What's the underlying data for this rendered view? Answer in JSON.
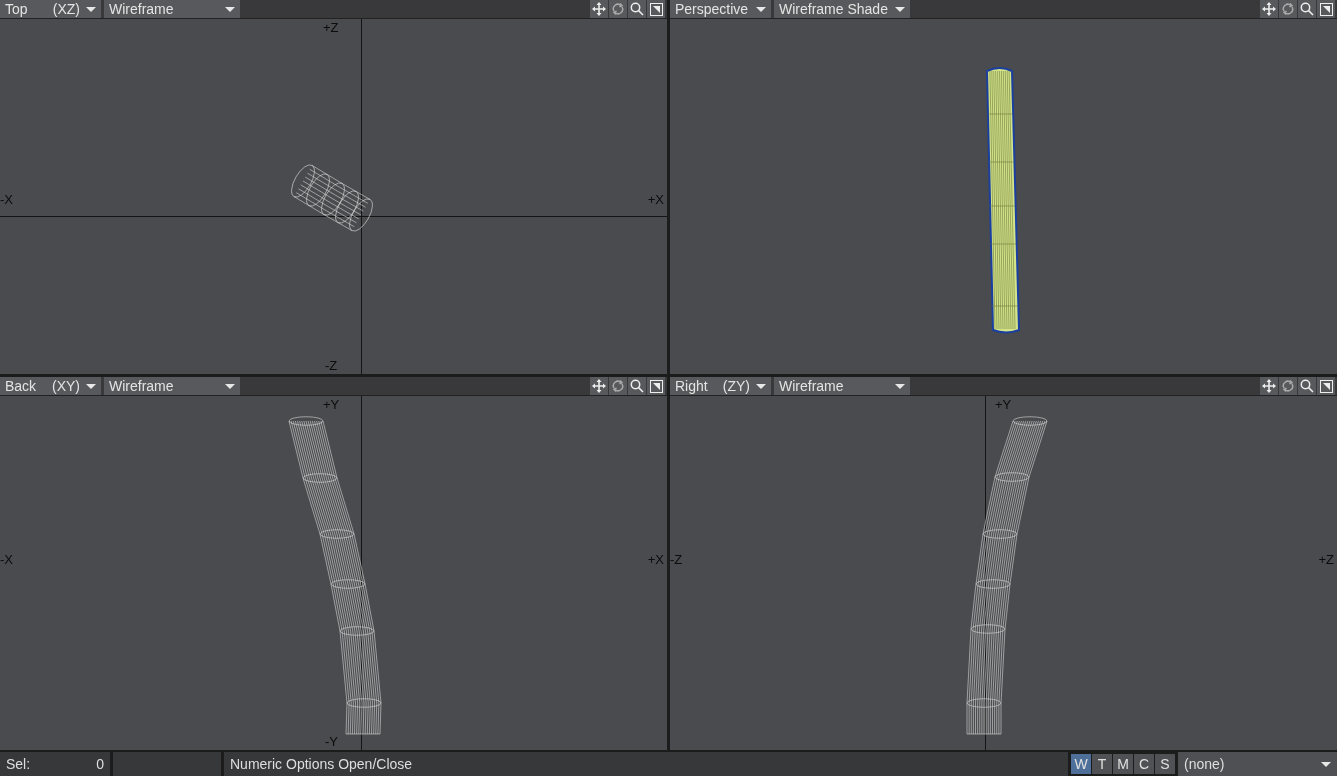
{
  "viewports": [
    {
      "kind": "ortho",
      "view": "Top",
      "axes": "(XZ)",
      "mode": "Wireframe",
      "axis_labels": {
        "top": "+Z",
        "bottom": "-Z",
        "left": "-X",
        "right": "+X"
      }
    },
    {
      "kind": "perspective",
      "view": "Perspective",
      "mode": "Wireframe Shade"
    },
    {
      "kind": "ortho",
      "view": "Back",
      "axes": "(XY)",
      "mode": "Wireframe",
      "axis_labels": {
        "top": "+Y",
        "bottom": "-Y",
        "left": "-X",
        "right": "+X"
      }
    },
    {
      "kind": "ortho",
      "view": "Right",
      "axes": "(ZY)",
      "mode": "Wireframe",
      "axis_labels": {
        "top": "+Y",
        "left": "-Z",
        "right": "+Z"
      }
    }
  ],
  "status_bar": {
    "sel_label": "Sel:",
    "sel_count": "0",
    "message": "Numeric Options Open/Close",
    "mode_buttons": [
      {
        "label": "W",
        "selected": true
      },
      {
        "label": "T",
        "selected": false
      },
      {
        "label": "M",
        "selected": false
      },
      {
        "label": "C",
        "selected": false
      },
      {
        "label": "S",
        "selected": false
      }
    ],
    "layer_dropdown": "(none)"
  }
}
